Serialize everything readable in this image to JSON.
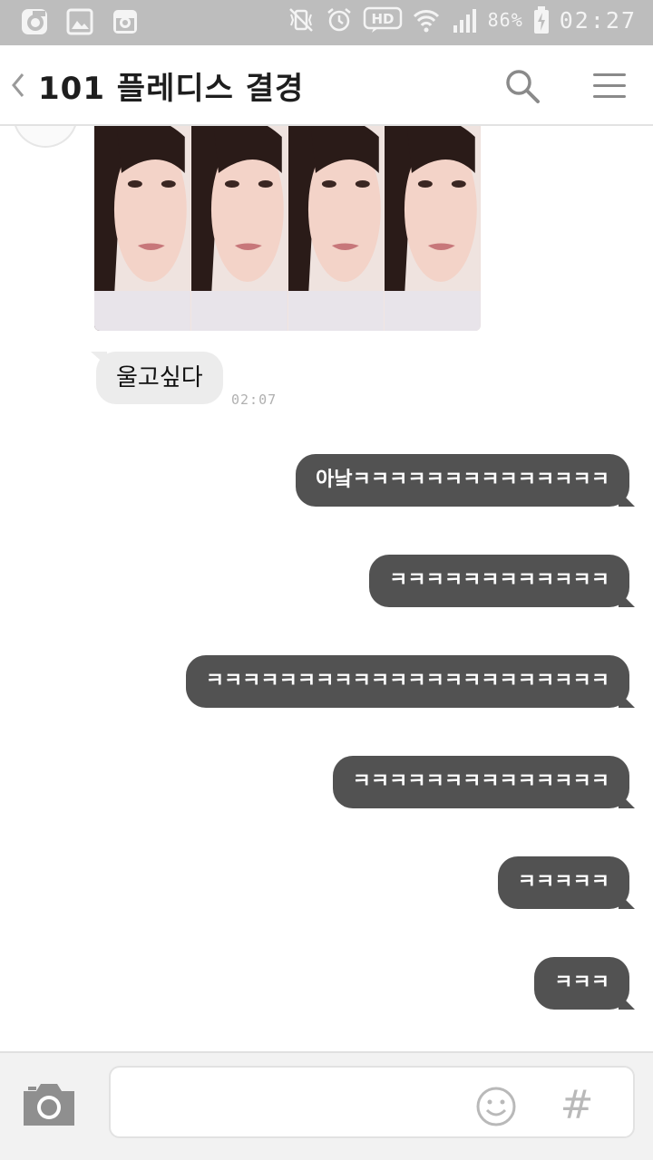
{
  "status_bar": {
    "battery": "86%",
    "time": "02:27",
    "icons": [
      "opera-icon",
      "gallery-icon",
      "instagram-icon",
      "vibrate-mute-icon",
      "alarm-icon",
      "hd-voice-icon",
      "wifi-icon",
      "signal-icon",
      "battery-charging-icon"
    ]
  },
  "header": {
    "back_icon": "chevron-left-icon",
    "title": "101 플레디스 결경",
    "search_icon": "search-icon",
    "menu_icon": "hamburger-menu-icon"
  },
  "messages": {
    "incoming": [
      {
        "type": "image"
      },
      {
        "type": "text",
        "text": "울고싶다",
        "time": "02:07"
      }
    ],
    "outgoing": [
      {
        "text": "아낰ㅋㅋㅋㅋㅋㅋㅋㅋㅋㅋㅋㅋㅋㅋ"
      },
      {
        "text": "ㅋㅋㅋㅋㅋㅋㅋㅋㅋㅋㅋㅋ"
      },
      {
        "text": "ㅋㅋㅋㅋㅋㅋㅋㅋㅋㅋㅋㅋㅋㅋㅋㅋㅋㅋㅋㅋㅋㅋ"
      },
      {
        "text": "ㅋㅋㅋㅋㅋㅋㅋㅋㅋㅋㅋㅋㅋㅋ"
      },
      {
        "text": "ㅋㅋㅋㅋㅋ"
      },
      {
        "text": "ㅋㅋㅋ"
      }
    ]
  },
  "input_bar": {
    "camera_icon": "camera-icon",
    "value": "",
    "placeholder": "",
    "emoji_icon": "smiley-icon",
    "hash_label": "#"
  },
  "colors": {
    "status_bar_bg": "#bdbdbd",
    "incoming_bubble": "#ececec",
    "outgoing_bubble": "#525252",
    "input_bar_bg": "#f2f2f2"
  }
}
